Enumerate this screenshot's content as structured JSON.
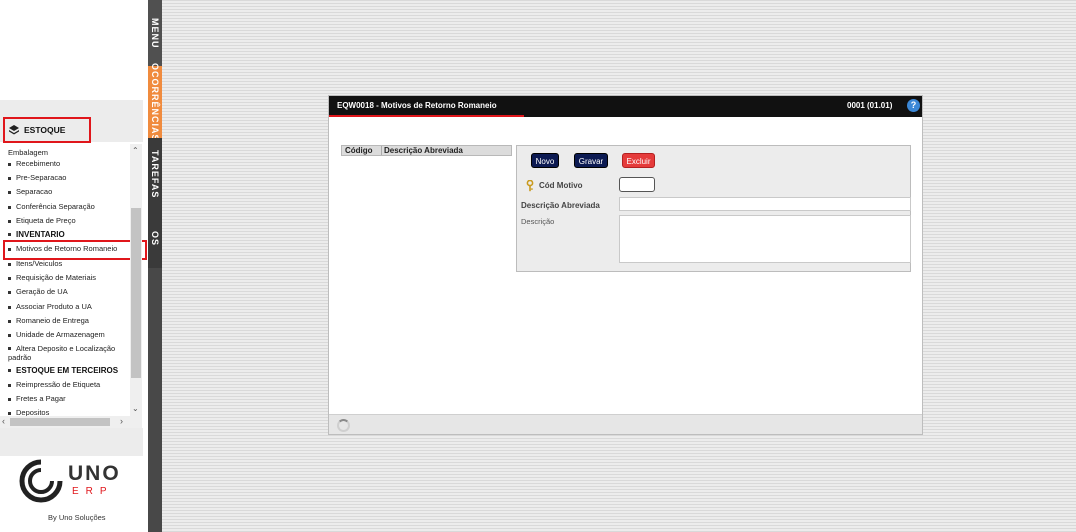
{
  "sidebar": {
    "module_title": "ESTOQUE",
    "items": [
      {
        "label": "Embalagem",
        "type": "item"
      },
      {
        "label": "Recebimento",
        "type": "item"
      },
      {
        "label": "Pre-Separacao",
        "type": "item"
      },
      {
        "label": "Separacao",
        "type": "item"
      },
      {
        "label": "Conferência Separação",
        "type": "item"
      },
      {
        "label": "Etiqueta de Preço",
        "type": "item"
      },
      {
        "label": "INVENTARIO",
        "type": "header"
      },
      {
        "label": "Motivos de Retorno Romaneio",
        "type": "item",
        "highlighted": true
      },
      {
        "label": "Itens/Veiculos",
        "type": "item"
      },
      {
        "label": "Requisição de Materiais",
        "type": "item"
      },
      {
        "label": "Geração de UA",
        "type": "item"
      },
      {
        "label": "Associar Produto a UA",
        "type": "item"
      },
      {
        "label": "Romaneio de Entrega",
        "type": "item"
      },
      {
        "label": "Unidade de Armazenagem",
        "type": "item"
      },
      {
        "label": "Altera Deposito e Localização padrão",
        "type": "item"
      },
      {
        "label": "ESTOQUE EM TERCEIROS",
        "type": "header"
      },
      {
        "label": "Reimpressão de Etiqueta",
        "type": "item"
      },
      {
        "label": "Fretes a Pagar",
        "type": "item"
      },
      {
        "label": "Depositos",
        "type": "item"
      }
    ],
    "logo_text": "UNO",
    "logo_sub": "ERP",
    "byline": "By Uno Soluções"
  },
  "tabs": {
    "menu": "MENU",
    "ocorrencias": "OCORRÊNCIAS",
    "tarefas": "TAREFAS",
    "os": "OS"
  },
  "window": {
    "title": "EQW0018 - Motivos de Retorno Romaneio",
    "version": "0001 (01.01)",
    "help": "?"
  },
  "grid": {
    "columns": [
      "Código",
      "Descrição Abreviada"
    ]
  },
  "form": {
    "buttons": {
      "novo": "Novo",
      "gravar": "Gravar",
      "excluir": "Excluir"
    },
    "fields": {
      "cod_motivo": {
        "label": "Cód Motivo",
        "value": ""
      },
      "descricao_abreviada": {
        "label": "Descrição Abreviada",
        "value": ""
      },
      "descricao": {
        "label": "Descrição",
        "value": ""
      }
    }
  },
  "colors": {
    "accent_red": "#e0161b",
    "tab_orange": "#f08b3e",
    "button_navy": "#0c1a52",
    "button_red": "#e53b3b",
    "titlebar": "#111111"
  },
  "icons": [
    "stack-icon",
    "key-icon",
    "help-icon",
    "spinner-icon",
    "chevron-up-icon",
    "chevron-down-icon",
    "chevron-left-icon",
    "chevron-right-icon",
    "uno-logo-icon"
  ]
}
